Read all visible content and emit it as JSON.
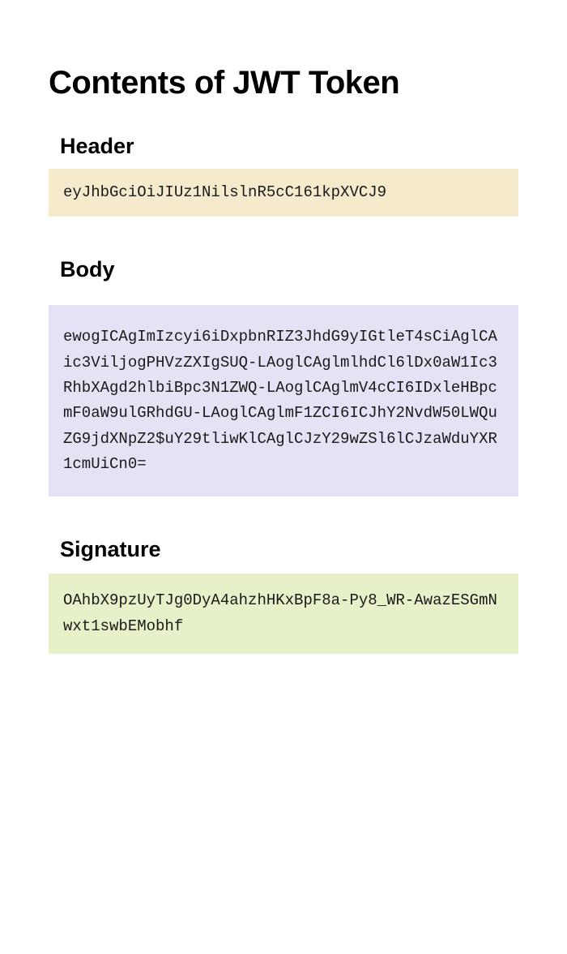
{
  "title": "Contents of JWT Token",
  "sections": {
    "header": {
      "label": "Header",
      "content": "eyJhbGciOiJIUz1NilslnR5cC161kpXVCJ9"
    },
    "body": {
      "label": "Body",
      "content": "ewogICAgImIzcyi6iDxpbnRIZ3JhdG9yIGtleT4sCiAglCAic3ViljogPHVzZXIgSUQ-LAoglCAglmlhdCl6lDx0aW1Ic3RhbXAgd2hlbiBpc3N1ZWQ-LAoglCAglmV4cCI6IDxleHBpcmF0aW9ulGRhdGU-LAoglCAglmF1ZCI6ICJhY2NvdW50LWQuZG9jdXNpZ2$uY29tliwKlCAglCJzY29wZSl6lCJzaWduYXR1cmUiCn0="
    },
    "signature": {
      "label": "Signature",
      "content": "OAhbX9pzUyTJg0DyA4ahzhHKxBpF8a-Py8_WR-AwazESGmNwxt1swbEMobhf"
    }
  }
}
